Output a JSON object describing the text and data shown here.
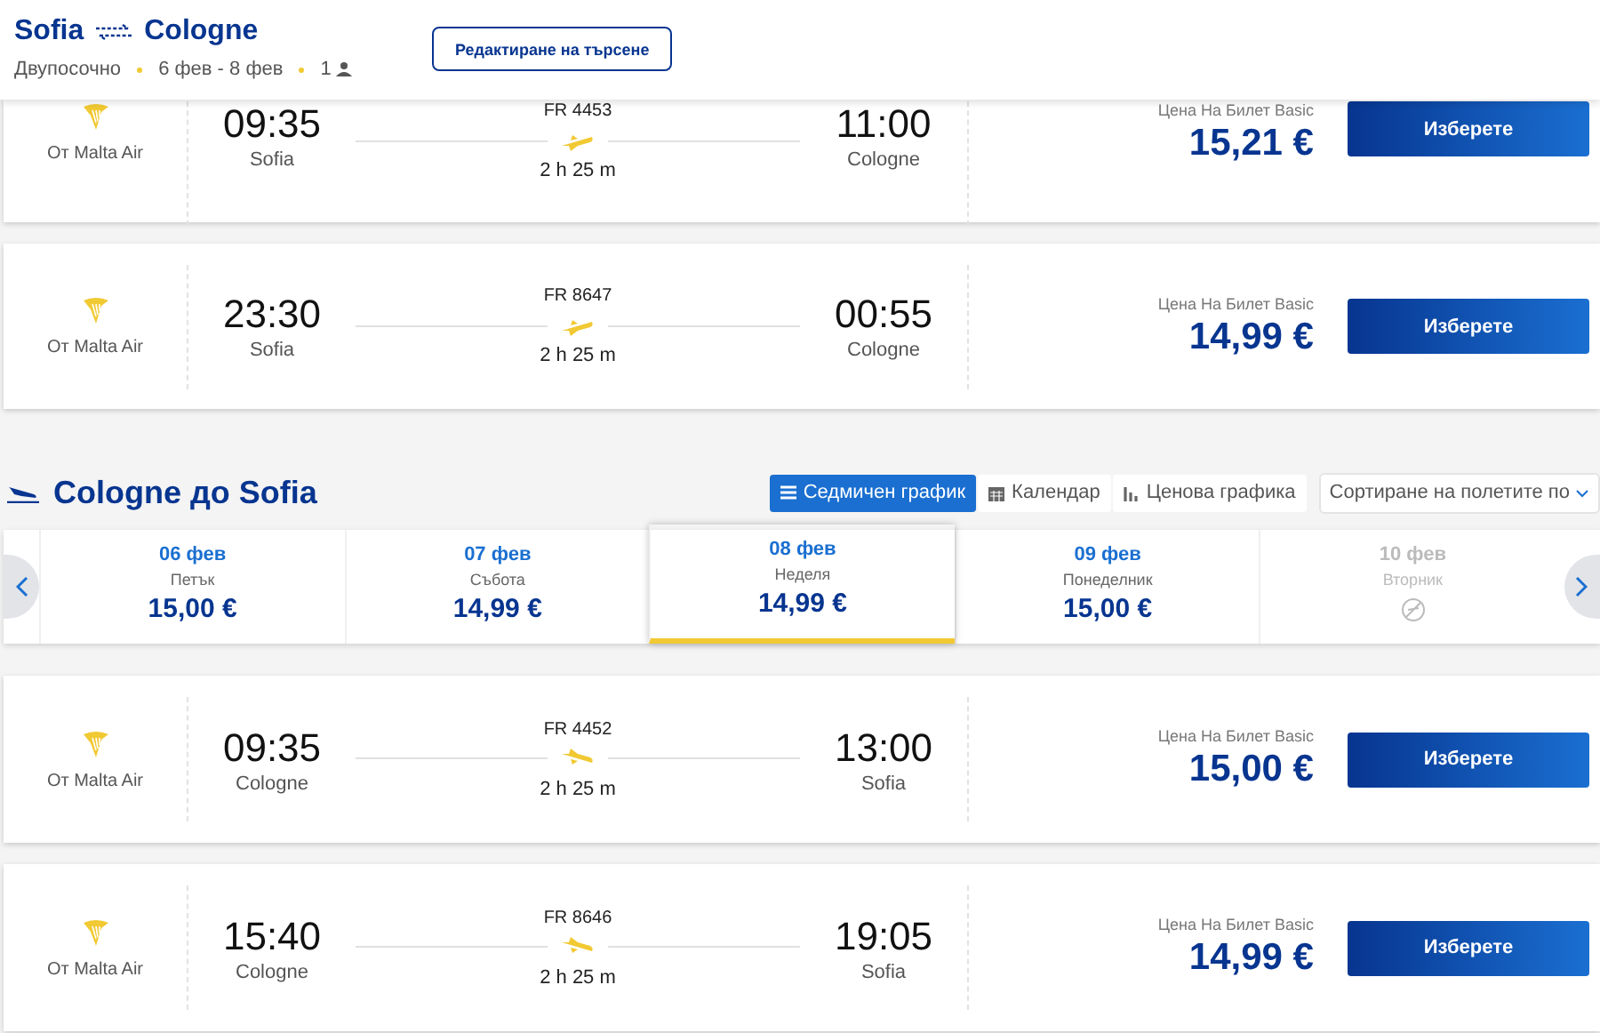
{
  "header": {
    "from": "Sofia",
    "to": "Cologne",
    "trip_type": "Двупосочно",
    "dates": "6 фев - 8 фев",
    "passengers": "1",
    "edit_button": "Редактиране на търсене"
  },
  "outbound_flights": [
    {
      "airline": "От Malta Air",
      "departure_time": "09:35",
      "departure_city": "Sofia",
      "flight_number": "FR 4453",
      "duration": "2 h 25 m",
      "arrival_time": "11:00",
      "arrival_city": "Cologne",
      "fare_label": "Цена На Билет Basic",
      "price": "15,21 €",
      "button": "Изберете"
    },
    {
      "airline": "От Malta Air",
      "departure_time": "23:30",
      "departure_city": "Sofia",
      "flight_number": "FR 8647",
      "duration": "2 h 25 m",
      "arrival_time": "00:55",
      "arrival_city": "Cologne",
      "fare_label": "Цена На Билет Basic",
      "price": "14,99 €",
      "button": "Изберете"
    }
  ],
  "return_section": {
    "title": "Cologne до Sofia",
    "views": [
      {
        "kind": "list",
        "label": "Седмичен график",
        "selected": true
      },
      {
        "kind": "calendar",
        "label": "Календар",
        "selected": false
      },
      {
        "kind": "chart",
        "label": "Ценова графика",
        "selected": false
      }
    ],
    "sort_label": "Сортиране на полетите по",
    "dates": [
      {
        "date": "06 фев",
        "weekday": "Петък",
        "price": "15,00 €",
        "selected": false,
        "disabled": false
      },
      {
        "date": "07 фев",
        "weekday": "Събота",
        "price": "14,99 €",
        "selected": false,
        "disabled": false
      },
      {
        "date": "08 фев",
        "weekday": "Неделя",
        "price": "14,99 €",
        "selected": true,
        "disabled": false
      },
      {
        "date": "09 фев",
        "weekday": "Понеделник",
        "price": "15,00 €",
        "selected": false,
        "disabled": false
      },
      {
        "date": "10 фев",
        "weekday": "Вторник",
        "selected": false,
        "disabled": true
      }
    ],
    "flights": [
      {
        "airline": "От Malta Air",
        "departure_time": "09:35",
        "departure_city": "Cologne",
        "flight_number": "FR 4452",
        "duration": "2 h 25 m",
        "arrival_time": "13:00",
        "arrival_city": "Sofia",
        "fare_label": "Цена На Билет Basic",
        "price": "15,00 €",
        "button": "Изберете"
      },
      {
        "airline": "От Malta Air",
        "departure_time": "15:40",
        "departure_city": "Cologne",
        "flight_number": "FR 8646",
        "duration": "2 h 25 m",
        "arrival_time": "19:05",
        "arrival_city": "Sofia",
        "fare_label": "Цена На Билет Basic",
        "price": "14,99 €",
        "button": "Изберете"
      }
    ]
  }
}
